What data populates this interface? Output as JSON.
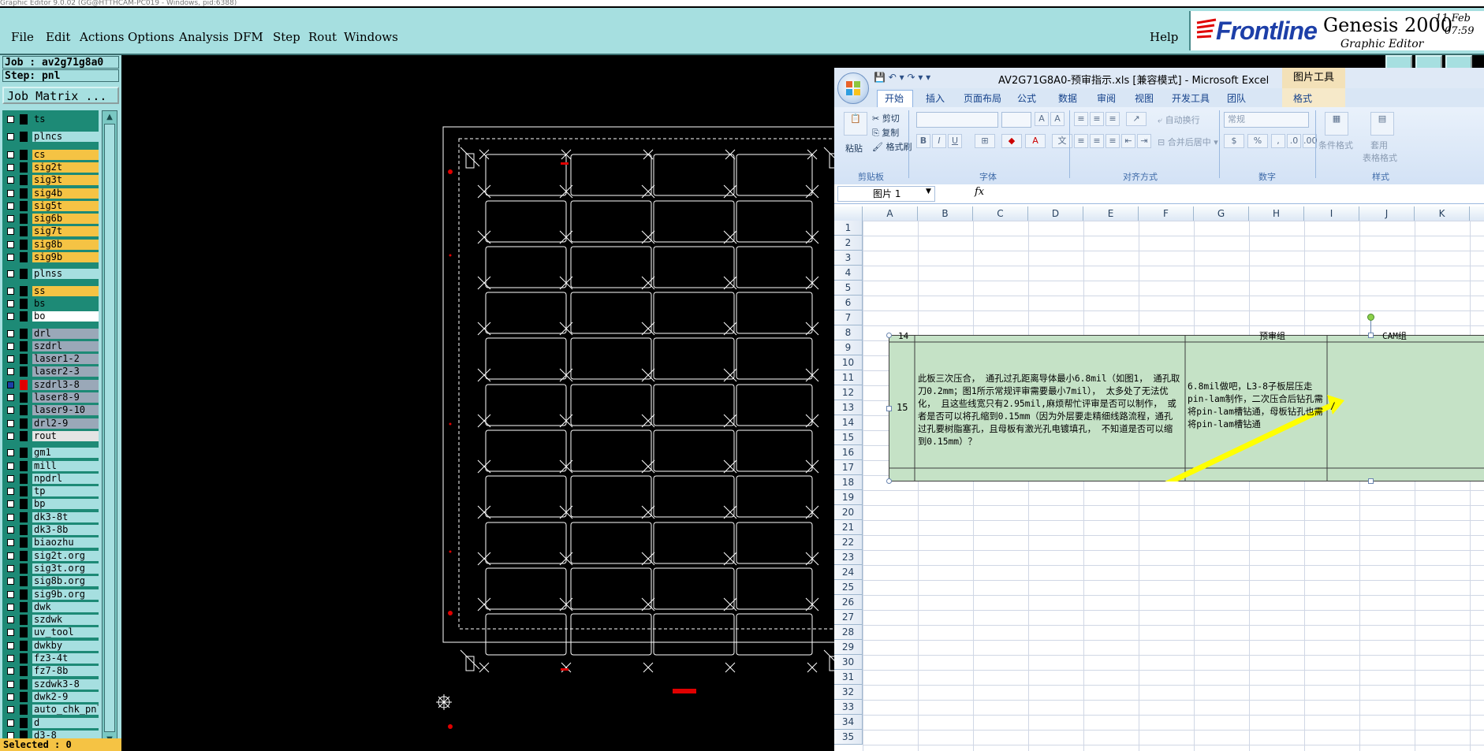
{
  "titlebar": {
    "text": "Graphic Editor 9.0.02 (GG@HTTHCAM-PC019 - Windows, pid:6388)"
  },
  "genesis": {
    "menu": [
      "File",
      "Edit",
      "Actions",
      "Options",
      "Analysis",
      "DFM",
      "Step",
      "Rout",
      "Windows"
    ],
    "help": "Help",
    "logo": {
      "brand": "Frontline",
      "product": "Genesis 2000",
      "subtitle": "Graphic Editor",
      "date": "11 Feb",
      "time": "07:59"
    },
    "job_label": "Job : av2g71g8a0",
    "step_label": "Step: pnl",
    "job_matrix": "Job Matrix ...",
    "selected": "Selected : 0",
    "layers": [
      {
        "name": "ts",
        "color": "#1d8a76",
        "on": false,
        "swatch": "black"
      },
      {
        "name": "plncs",
        "color": "#a6dfe0",
        "on": false,
        "swatch": "black"
      },
      {
        "name": "cs",
        "color": "#f5c344",
        "on": false,
        "swatch": "black"
      },
      {
        "name": "sig2t",
        "color": "#f5c344",
        "on": false,
        "swatch": "black"
      },
      {
        "name": "sig3t",
        "color": "#f5c344",
        "on": false,
        "swatch": "black"
      },
      {
        "name": "sig4b",
        "color": "#f5c344",
        "on": false,
        "swatch": "black"
      },
      {
        "name": "sig5t",
        "color": "#f5c344",
        "on": false,
        "swatch": "black"
      },
      {
        "name": "sig6b",
        "color": "#f5c344",
        "on": false,
        "swatch": "black"
      },
      {
        "name": "sig7t",
        "color": "#f5c344",
        "on": false,
        "swatch": "black"
      },
      {
        "name": "sig8b",
        "color": "#f5c344",
        "on": false,
        "swatch": "black"
      },
      {
        "name": "sig9b",
        "color": "#f5c344",
        "on": false,
        "swatch": "black"
      },
      {
        "name": "plnss",
        "color": "#a6dfe0",
        "on": false,
        "swatch": "black"
      },
      {
        "name": "ss",
        "color": "#f5c344",
        "on": false,
        "swatch": "black"
      },
      {
        "name": "bs",
        "color": "#1d8a76",
        "on": false,
        "swatch": "black"
      },
      {
        "name": "bo",
        "color": "#ffffff",
        "on": false,
        "swatch": "black"
      },
      {
        "name": "drl",
        "color": "#9aa8b8",
        "on": false,
        "swatch": "black"
      },
      {
        "name": "szdrl",
        "color": "#9aa8b8",
        "on": false,
        "swatch": "black"
      },
      {
        "name": "laser1-2",
        "color": "#9aa8b8",
        "on": false,
        "swatch": "black"
      },
      {
        "name": "laser2-3",
        "color": "#9aa8b8",
        "on": false,
        "swatch": "black"
      },
      {
        "name": "szdrl3-8",
        "color": "#9aa8b8",
        "on": true,
        "swatch": "red"
      },
      {
        "name": "laser8-9",
        "color": "#9aa8b8",
        "on": false,
        "swatch": "black"
      },
      {
        "name": "laser9-10",
        "color": "#9aa8b8",
        "on": false,
        "swatch": "black"
      },
      {
        "name": "drl2-9",
        "color": "#9aa8b8",
        "on": false,
        "swatch": "black"
      },
      {
        "name": "rout",
        "color": "#e4e4e4",
        "on": false,
        "swatch": "black"
      },
      {
        "name": "gm1",
        "color": "#a6dfe0",
        "on": false,
        "swatch": "black"
      },
      {
        "name": "mill",
        "color": "#a6dfe0",
        "on": false,
        "swatch": "black"
      },
      {
        "name": "npdrl",
        "color": "#a6dfe0",
        "on": false,
        "swatch": "black"
      },
      {
        "name": "tp",
        "color": "#a6dfe0",
        "on": false,
        "swatch": "black"
      },
      {
        "name": "bp",
        "color": "#a6dfe0",
        "on": false,
        "swatch": "black"
      },
      {
        "name": "dk3-8t",
        "color": "#a6dfe0",
        "on": false,
        "swatch": "black"
      },
      {
        "name": "dk3-8b",
        "color": "#a6dfe0",
        "on": false,
        "swatch": "black"
      },
      {
        "name": "biaozhu",
        "color": "#a6dfe0",
        "on": false,
        "swatch": "black"
      },
      {
        "name": "sig2t.org",
        "color": "#a6dfe0",
        "on": false,
        "swatch": "black"
      },
      {
        "name": "sig3t.org",
        "color": "#a6dfe0",
        "on": false,
        "swatch": "black"
      },
      {
        "name": "sig8b.org",
        "color": "#a6dfe0",
        "on": false,
        "swatch": "black"
      },
      {
        "name": "sig9b.org",
        "color": "#a6dfe0",
        "on": false,
        "swatch": "black"
      },
      {
        "name": "dwk",
        "color": "#a6dfe0",
        "on": false,
        "swatch": "black"
      },
      {
        "name": "szdwk",
        "color": "#a6dfe0",
        "on": false,
        "swatch": "black"
      },
      {
        "name": "uv_tool",
        "color": "#a6dfe0",
        "on": false,
        "swatch": "black"
      },
      {
        "name": "dwkby",
        "color": "#a6dfe0",
        "on": false,
        "swatch": "black"
      },
      {
        "name": "fz3-4t",
        "color": "#a6dfe0",
        "on": false,
        "swatch": "black"
      },
      {
        "name": "fz7-8b",
        "color": "#a6dfe0",
        "on": false,
        "swatch": "black"
      },
      {
        "name": "szdwk3-8",
        "color": "#a6dfe0",
        "on": false,
        "swatch": "black"
      },
      {
        "name": "dwk2-9",
        "color": "#a6dfe0",
        "on": false,
        "swatch": "black"
      },
      {
        "name": "auto_chk_pnl",
        "color": "#a6dfe0",
        "on": false,
        "swatch": "black"
      },
      {
        "name": "d",
        "color": "#a6dfe0",
        "on": false,
        "swatch": "black"
      },
      {
        "name": "d3-8",
        "color": "#a6dfe0",
        "on": false,
        "swatch": "black"
      }
    ]
  },
  "excel": {
    "title": "AV2G71G8A0-预审指示.xls  [兼容模式] - Microsoft Excel",
    "context_tab_group": "图片工具",
    "tabs": [
      "开始",
      "插入",
      "页面布局",
      "公式",
      "数据",
      "审阅",
      "视图",
      "开发工具",
      "团队",
      "格式"
    ],
    "active_tab": "开始",
    "ribbon": {
      "clipboard": {
        "paste": "粘贴",
        "cut": "剪切",
        "copy": "复制",
        "format_painter": "格式刷",
        "label": "剪贴板"
      },
      "font": {
        "label": "字体"
      },
      "alignment": {
        "wrap": "自动换行",
        "merge": "合并后居中",
        "label": "对齐方式"
      },
      "number": {
        "format": "常规",
        "label": "数字"
      },
      "styles": {
        "conditional": "条件格式",
        "table": "套用",
        "table2": "表格格式",
        "label": "样式"
      }
    },
    "name_box": "图片 1",
    "fx": "fx",
    "columns": [
      "A",
      "B",
      "C",
      "D",
      "E",
      "F",
      "G",
      "H",
      "I",
      "J",
      "K"
    ],
    "rows": [
      "1",
      "2",
      "3",
      "4",
      "5",
      "6",
      "7",
      "8",
      "9",
      "10",
      "11",
      "12",
      "13",
      "14",
      "15",
      "16",
      "17",
      "18",
      "19",
      "20",
      "21",
      "22",
      "23",
      "24",
      "25",
      "26",
      "27",
      "28",
      "29",
      "30",
      "31",
      "32",
      "33",
      "34",
      "35"
    ],
    "picture": {
      "row_top": "14",
      "row_main": "15",
      "header_h": "预审组",
      "header_k": "CAM组",
      "text_main": "此板三次压合， 通孔过孔距离导体最小6.8mil（如图1， 通孔取刀0.2mm；图1所示常规评审需要最小7mil）， 太多处了无法优化， 且这些线宽只有2.95mil,麻烦帮忙评审是否可以制作， 或者是否可以将孔缩到0.15mm（因为外层要走精细线路流程，通孔过孔要树脂塞孔，且母板有激光孔电镀填孔， 不知道是否可以缩到0.15mm）？",
      "text_reply": "6.8mil做吧，L3-8子板层压走pin-lam制作，二次压合后钻孔需将pin-lam槽钻通，母板钻孔也需将pin-lam槽钻通",
      "text_cam": "/"
    }
  }
}
